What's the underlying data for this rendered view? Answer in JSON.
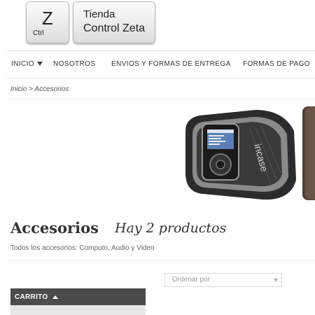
{
  "logo": {
    "key_letter": "Z",
    "key_sub": "Ctrl",
    "name_line1": "Tienda",
    "name_line2": "Control Zeta"
  },
  "nav": {
    "items": [
      "INICIO",
      "NOSOTROS",
      "ENVIOS Y FORMAS DE ENTREGA",
      "FORMAS DE PAGO"
    ]
  },
  "breadcrumb": {
    "home": "Inicio",
    "separator": ">",
    "current": "Accesorios"
  },
  "banner": {
    "icon": "armband-product-image"
  },
  "category": {
    "title": "Accesorios",
    "count": "Hay 2 productos",
    "description": "Todos los accesorios: Computo, Audio y Video"
  },
  "sort": {
    "placeholder": "Ordenar por"
  },
  "cart": {
    "label": "CARRITO"
  },
  "colors": {
    "cart_bg": "#4b4b4b",
    "accent": "#6a5647"
  }
}
